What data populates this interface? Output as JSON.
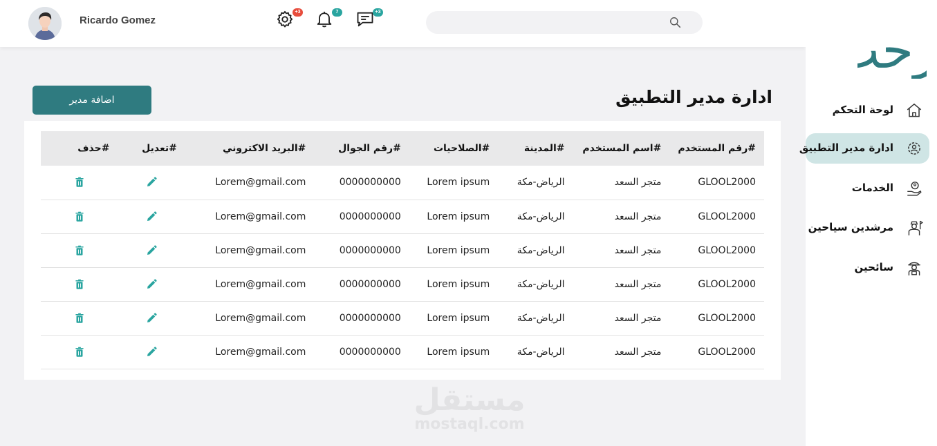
{
  "header": {
    "user_name": "Ricardo Gomez",
    "settings_badge": "+3",
    "notifications_badge": "7",
    "messages_badge": "+3",
    "search_placeholder": "",
    "badge_colors": {
      "settings": "#e74c3c",
      "notifications": "#2aa5a0",
      "messages": "#2aa5a0"
    }
  },
  "sidebar": {
    "logo_text": "أرحب",
    "items": [
      {
        "label": "لوحة التحكم",
        "icon": "home-icon",
        "active": false
      },
      {
        "label": "ادارة مدير التطبيق",
        "icon": "admin-gear-icon",
        "active": true
      },
      {
        "label": "الخدمات",
        "icon": "services-hand-icon",
        "active": false
      },
      {
        "label": "مرشدين سياحين",
        "icon": "tour-guide-icon",
        "active": false
      },
      {
        "label": "سائحين",
        "icon": "tourist-icon",
        "active": false
      }
    ]
  },
  "main": {
    "title": "ادارة مدير التطبيق",
    "add_button": "اضافة مدير",
    "table": {
      "columns": [
        "#رقم المستخدم",
        "#اسم المستخدم",
        "#المدينة",
        "#الصلاحيات",
        "#رقم الجوال",
        "#البريد الاكتروني",
        "#تعديل",
        "#حذف"
      ],
      "rows": [
        [
          "GLOOL2000",
          "متجر السعد",
          "الرياض-مكة",
          "Lorem ipsum",
          "0000000000",
          "Lorem@gmail.com"
        ],
        [
          "GLOOL2000",
          "متجر السعد",
          "الرياض-مكة",
          "Lorem ipsum",
          "0000000000",
          "Lorem@gmail.com"
        ],
        [
          "GLOOL2000",
          "متجر السعد",
          "الرياض-مكة",
          "Lorem ipsum",
          "0000000000",
          "Lorem@gmail.com"
        ],
        [
          "GLOOL2000",
          "متجر السعد",
          "الرياض-مكة",
          "Lorem ipsum",
          "0000000000",
          "Lorem@gmail.com"
        ],
        [
          "GLOOL2000",
          "متجر السعد",
          "الرياض-مكة",
          "Lorem ipsum",
          "0000000000",
          "Lorem@gmail.com"
        ],
        [
          "GLOOL2000",
          "متجر السعد",
          "الرياض-مكة",
          "Lorem ipsum",
          "0000000000",
          "Lorem@gmail.com"
        ]
      ],
      "edit_icon": "pencil-icon",
      "delete_icon": "trash-icon"
    }
  },
  "watermark": {
    "arabic": "مستقل",
    "latin": "mostaql.com"
  },
  "colors": {
    "accent": "#2f7b80",
    "active_nav": "#cfe5e5",
    "action_icon": "#2aa5a0",
    "page_bg": "#f2f2f4"
  }
}
